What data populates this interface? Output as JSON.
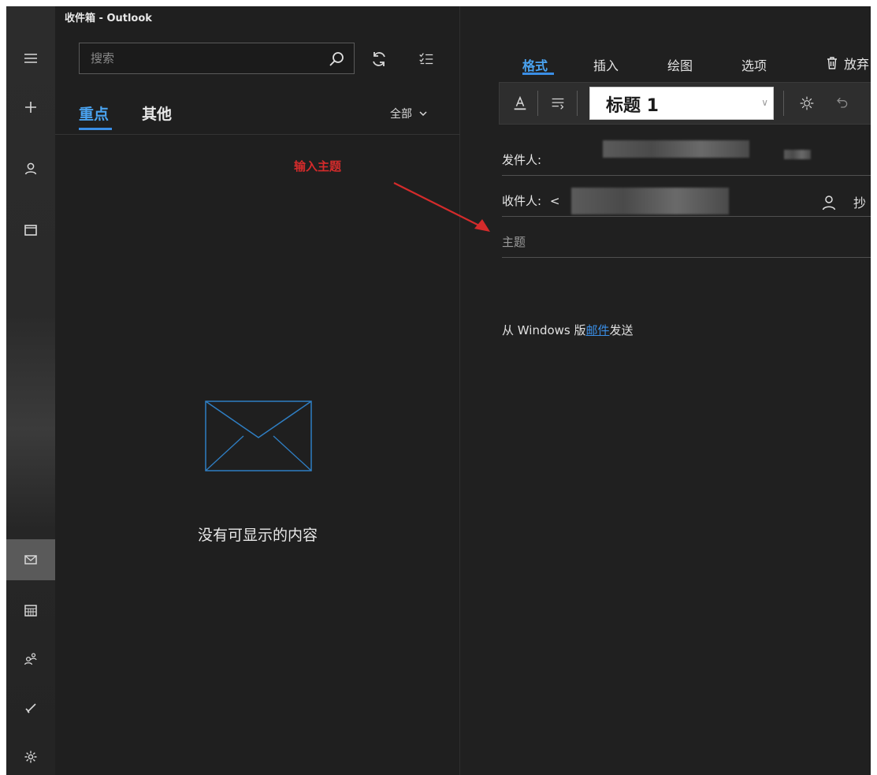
{
  "window": {
    "title": "收件箱 - Outlook"
  },
  "rail": {
    "items": [
      {
        "icon": "hamburger-icon"
      },
      {
        "icon": "plus-icon"
      },
      {
        "icon": "person-icon"
      },
      {
        "icon": "folder-icon"
      },
      {
        "icon": "mail-icon",
        "active": true
      },
      {
        "icon": "calendar-icon"
      },
      {
        "icon": "people-icon"
      },
      {
        "icon": "todo-check-icon"
      },
      {
        "icon": "gear-icon"
      }
    ]
  },
  "list": {
    "search": {
      "placeholder": "搜索"
    },
    "pivots": {
      "focused": "重点",
      "other": "其他"
    },
    "filter": {
      "label": "全部"
    },
    "annotation": "输入主题",
    "empty_text": "没有可显示的内容"
  },
  "compose": {
    "tabs": [
      "格式",
      "插入",
      "绘图",
      "选项"
    ],
    "discard_label": "放弃",
    "style_value": "标题 1",
    "from_label": "发件人:",
    "to_label": "收件人:",
    "to_prefix": "<",
    "cc_label": "抄",
    "subject_placeholder": "主题",
    "signature": {
      "prefix": "从 Windows 版",
      "link": "邮件",
      "suffix": "发送"
    }
  },
  "colors": {
    "accent": "#3a8ee6",
    "annotation": "#d42b2b",
    "background": "#202020"
  }
}
